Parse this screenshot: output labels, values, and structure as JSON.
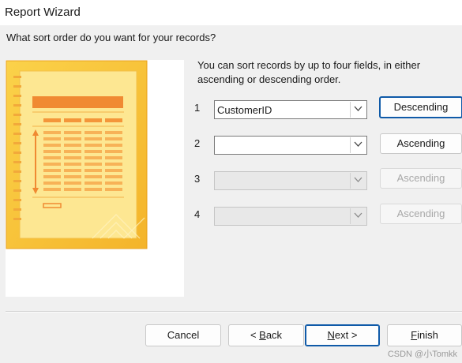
{
  "window": {
    "title": "Report Wizard"
  },
  "prompt": "What sort order do you want for your records?",
  "hint": "You can sort records by up to four fields, in either ascending or descending order.",
  "sort_rows": [
    {
      "number": "1",
      "field": "CustomerID",
      "order": "Descending",
      "enabled": true
    },
    {
      "number": "2",
      "field": "",
      "order": "Ascending",
      "enabled": true
    },
    {
      "number": "3",
      "field": "",
      "order": "Ascending",
      "enabled": false
    },
    {
      "number": "4",
      "field": "",
      "order": "Ascending",
      "enabled": false
    }
  ],
  "buttons": {
    "cancel": "Cancel",
    "back_prefix": "< ",
    "back_key": "B",
    "back_rest": "ack",
    "next_key": "N",
    "next_rest": "ext >",
    "finish_key": "F",
    "finish_rest": "inish"
  },
  "watermark": "CSDN @小Tomkk",
  "colors": {
    "accent": "#0f5aa8",
    "illustration_yellow": "#f6c33a",
    "illustration_orange": "#f08a32"
  }
}
